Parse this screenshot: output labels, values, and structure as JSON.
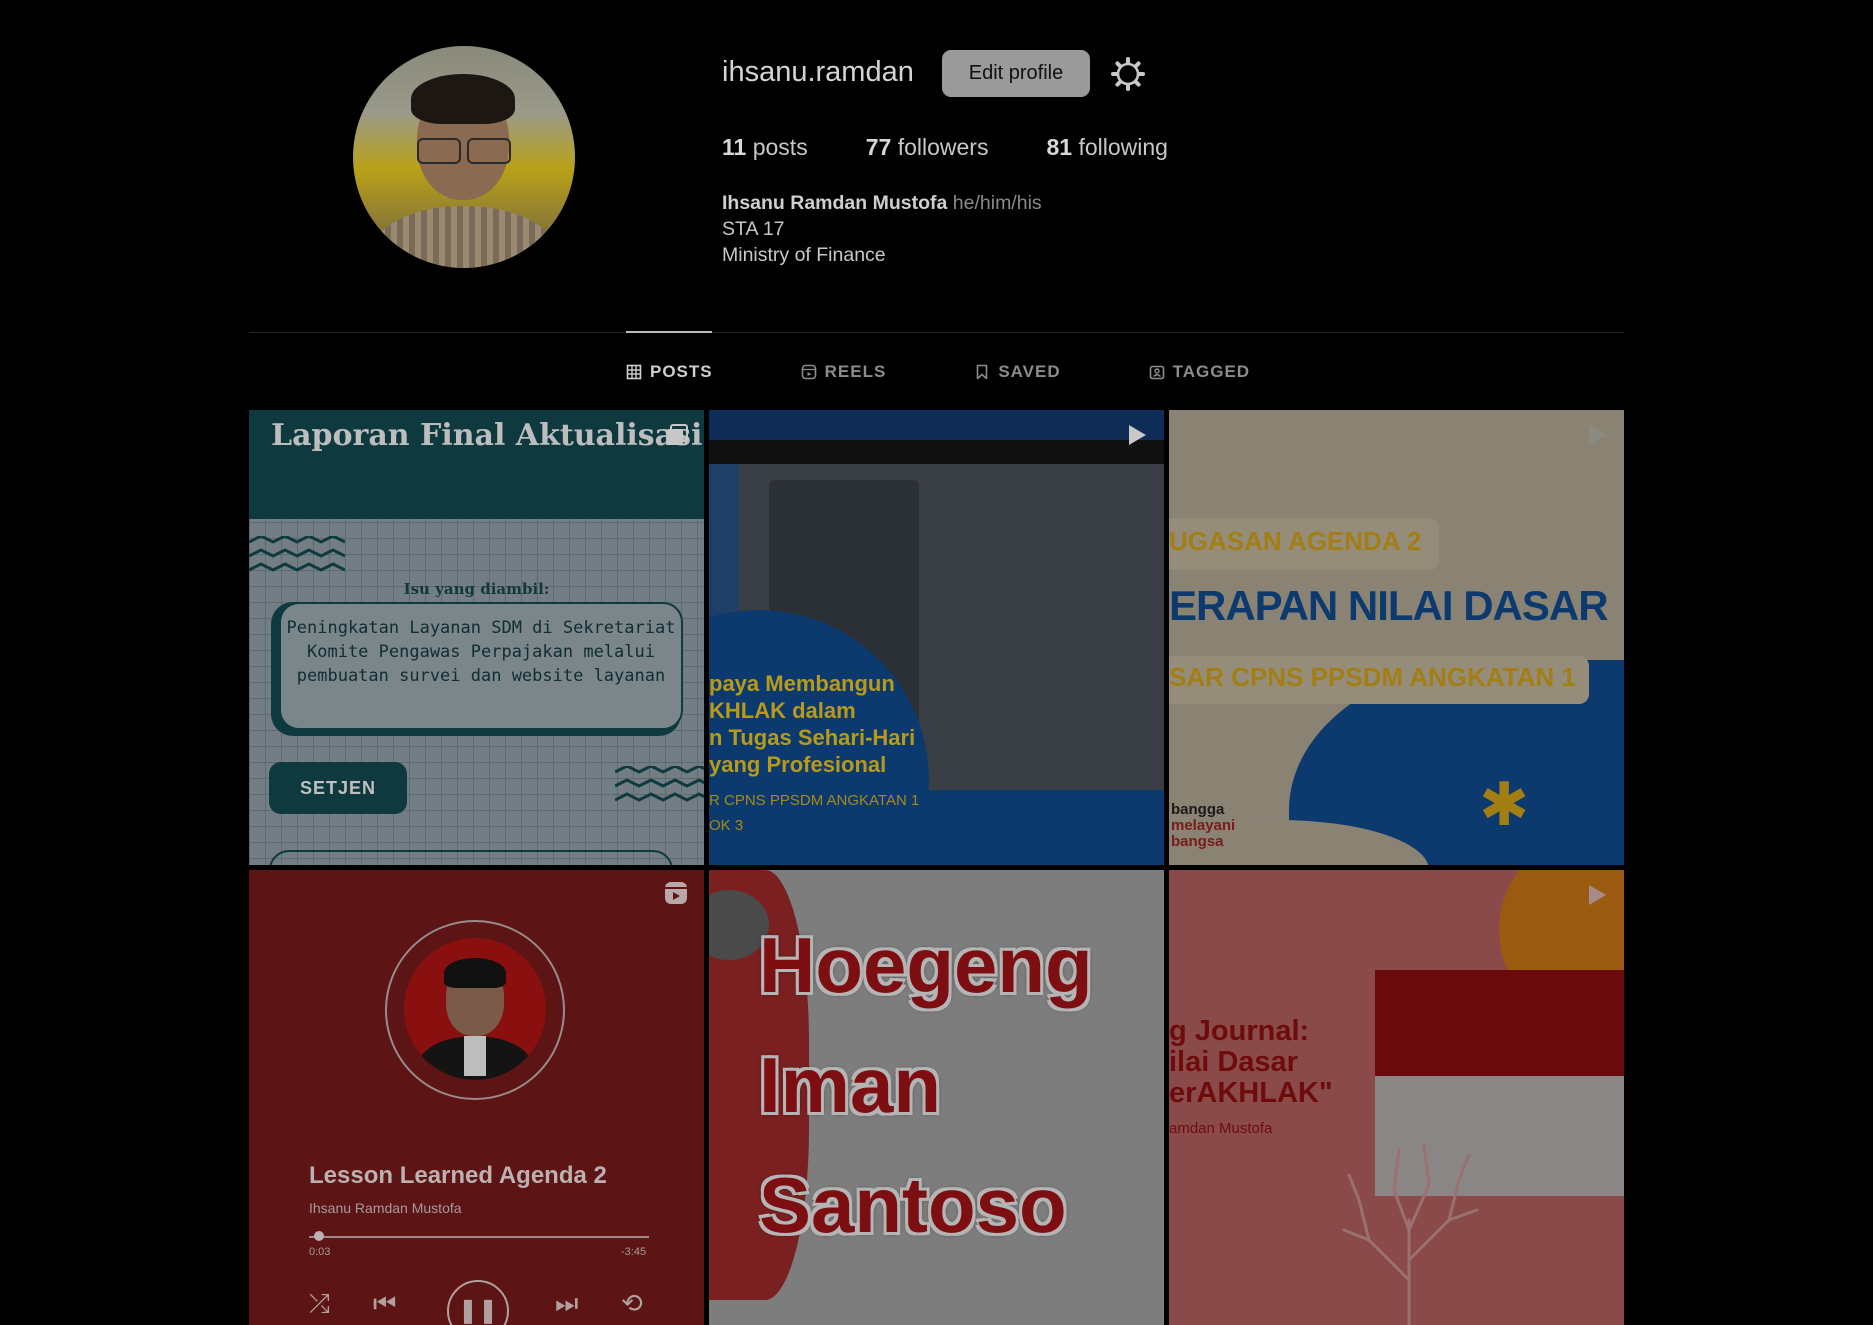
{
  "profile": {
    "username": "ihsanu.ramdan",
    "edit_label": "Edit profile",
    "posts_count": "11",
    "posts_label": "posts",
    "followers_count": "77",
    "followers_label": "followers",
    "following_count": "81",
    "following_label": "following",
    "full_name": "Ihsanu Ramdan Mustofa",
    "pronouns": "he/him/his",
    "bio_line1": "STA 17",
    "bio_line2": "Ministry of Finance"
  },
  "tabs": [
    {
      "label": "POSTS",
      "icon": "grid-icon",
      "active": true
    },
    {
      "label": "REELS",
      "icon": "reels-icon",
      "active": false
    },
    {
      "label": "SAVED",
      "icon": "bookmark-icon",
      "active": false
    },
    {
      "label": "TAGGED",
      "icon": "tagged-icon",
      "active": false
    }
  ],
  "posts": {
    "p1": {
      "title": "Laporan Final Aktualisasi",
      "isu_label": "Isu yang diambil:",
      "isu_text": "Peningkatan Layanan SDM di Sekretariat Komite Pengawas Perpajakan melalui pembuatan survei dan website layanan",
      "tag": "SETJEN"
    },
    "p2": {
      "headline": "paya Membangun\nKHLAK dalam\nn Tugas Sehari-Hari\nyang Profesional",
      "sub": "R CPNS PPSDM ANGKATAN 1\nOK 3"
    },
    "p3": {
      "line1": "UGASAN AGENDA 2",
      "line2": "ERAPAN NILAI DASAR",
      "line3": "SAR CPNS PPSDM ANGKATAN 1",
      "brand1": "bangga",
      "brand2": "melayani",
      "brand3": "bangsa"
    },
    "p4": {
      "song": "Lesson Learned Agenda 2",
      "artist": "Ihsanu Ramdan Mustofa",
      "time_current": "0:03",
      "time_remaining": "-3:45",
      "progress": 0.03
    },
    "p5": {
      "word1": "Hoegeng",
      "word2": "Iman",
      "word3": "Santoso"
    },
    "p6": {
      "headline": "g Journal:\nilai Dasar\nerAKHLAK\"",
      "byline": "amdan Mustofa"
    }
  },
  "colors": {
    "background": "#000000",
    "button": "#9a9a9a",
    "muted": "#8c8c8c"
  }
}
